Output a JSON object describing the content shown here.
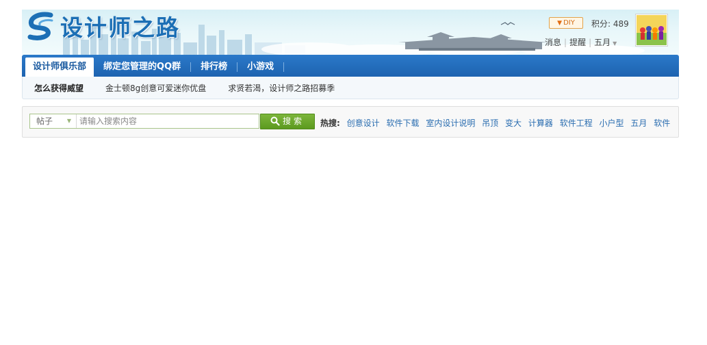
{
  "header": {
    "logo_text": "设计师之路",
    "diy_label": "DIY",
    "score_label": "积分: 489",
    "messages_label": "消息",
    "remind_label": "提醒",
    "username": "五月"
  },
  "nav": {
    "items": [
      {
        "label": "设计师俱乐部",
        "active": true
      },
      {
        "label": "绑定您管理的QQ群"
      },
      {
        "label": "排行榜"
      },
      {
        "label": "小游戏"
      }
    ]
  },
  "subnav": {
    "items": [
      {
        "label": "怎么获得威望"
      },
      {
        "label": "金士顿8g创意可爱迷你优盘"
      },
      {
        "label": "求贤若渴，设计师之路招募季"
      }
    ]
  },
  "search": {
    "type_label": "帖子",
    "placeholder": "请输入搜索内容",
    "button_label": "搜索",
    "hot_label": "热搜:",
    "hot_links": [
      "创意设计",
      "软件下载",
      "室内设计说明",
      "吊顶",
      "变大",
      "计算器",
      "软件工程",
      "小户型",
      "五月",
      "软件"
    ]
  },
  "colors": {
    "brand_blue": "#1d63b0",
    "search_green": "#5c9a1f",
    "link_blue": "#2a6db0"
  }
}
